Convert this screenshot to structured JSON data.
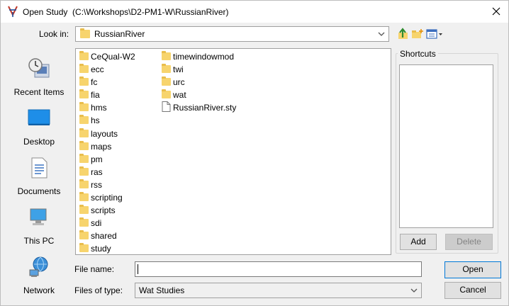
{
  "window": {
    "title": "Open Study",
    "path": "(C:\\Workshops\\D2-PM1-W\\RussianRiver)"
  },
  "look_in": {
    "label": "Look in:",
    "value": "RussianRiver"
  },
  "places": [
    {
      "label": "Recent Items",
      "icon": "recent-items-icon"
    },
    {
      "label": "Desktop",
      "icon": "desktop-icon"
    },
    {
      "label": "Documents",
      "icon": "documents-icon"
    },
    {
      "label": "This PC",
      "icon": "this-pc-icon"
    },
    {
      "label": "Network",
      "icon": "network-icon"
    }
  ],
  "files": {
    "column1": [
      "CeQual-W2",
      "ecc",
      "fc",
      "fia",
      "hms",
      "hs",
      "layouts",
      "maps",
      "pm",
      "ras",
      "rss",
      "scripting",
      "scripts",
      "sdi",
      "shared",
      "study"
    ],
    "column2": [
      {
        "name": "timewindowmod",
        "type": "folder"
      },
      {
        "name": "twi",
        "type": "folder"
      },
      {
        "name": "urc",
        "type": "folder"
      },
      {
        "name": "wat",
        "type": "folder"
      },
      {
        "name": "RussianRiver.sty",
        "type": "file"
      }
    ]
  },
  "shortcuts": {
    "title": "Shortcuts",
    "add_label": "Add",
    "delete_label": "Delete"
  },
  "file_name": {
    "label": "File name:",
    "value": ""
  },
  "file_type": {
    "label": "Files of type:",
    "value": "Wat Studies"
  },
  "buttons": {
    "open": "Open",
    "cancel": "Cancel"
  },
  "colors": {
    "accent": "#0078d7",
    "folder": "#f7d46d"
  }
}
